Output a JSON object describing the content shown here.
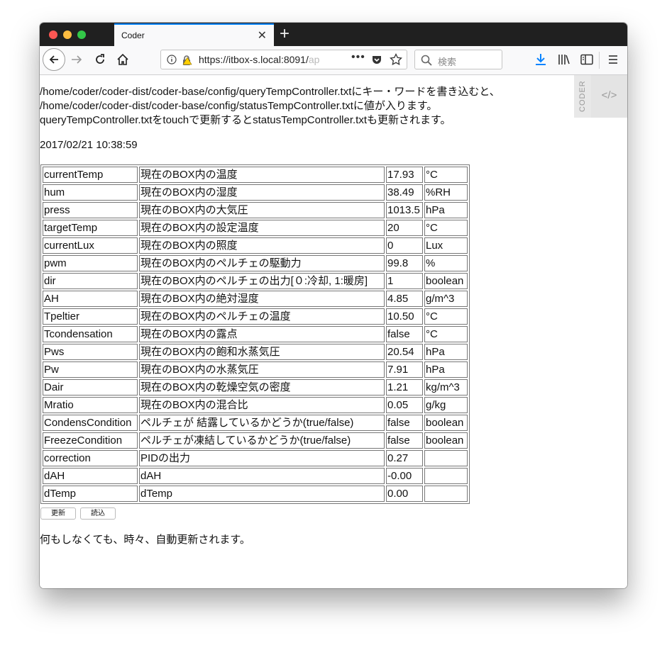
{
  "window": {
    "tab_title": "Coder"
  },
  "toolbar": {
    "url_main": "https://itbox-s.local:8091/",
    "url_faded": "ap",
    "url_more": "•••",
    "search_placeholder": "検索"
  },
  "sidebar": {
    "coder_label": "CODER",
    "code_label": "</>"
  },
  "intro": {
    "line1": "/home/coder/coder-dist/coder-base/config/queryTempController.txtにキー・ワードを書き込むと、",
    "line2": "/home/coder/coder-dist/coder-base/config/statusTempController.txtに値が入ります。",
    "line3": "queryTempController.txtをtouchで更新するとstatusTempController.txtも更新されます。"
  },
  "timestamp": "2017/02/21 10:38:59",
  "table": {
    "rows": [
      [
        "currentTemp",
        "現在のBOX内の温度",
        "17.93",
        "°C"
      ],
      [
        "hum",
        "現在のBOX内の湿度",
        "38.49",
        "%RH"
      ],
      [
        "press",
        "現在のBOX内の大気圧",
        "1013.5",
        "hPa"
      ],
      [
        "targetTemp",
        "現在のBOX内の設定温度",
        "20",
        "°C"
      ],
      [
        "currentLux",
        "現在のBOX内の照度",
        "0",
        "Lux"
      ],
      [
        "pwm",
        "現在のBOX内のペルチェの駆動力",
        "99.8",
        "%"
      ],
      [
        "dir",
        "現在のBOX内のペルチェの出力[０:冷却, 1:暖房]",
        "1",
        "boolean"
      ],
      [
        "AH",
        "現在のBOX内の絶対湿度",
        "4.85",
        "g/m^3"
      ],
      [
        "Tpeltier",
        "現在のBOX内のペルチェの温度",
        "10.50",
        "°C"
      ],
      [
        "Tcondensation",
        "現在のBOX内の露点",
        "false",
        "°C"
      ],
      [
        "Pws",
        "現在のBOX内の飽和水蒸気圧",
        "20.54",
        "hPa"
      ],
      [
        "Pw",
        "現在のBOX内の水蒸気圧",
        "7.91",
        "hPa"
      ],
      [
        "Dair",
        "現在のBOX内の乾燥空気の密度",
        "1.21",
        "kg/m^3"
      ],
      [
        "Mratio",
        "現在のBOX内の混合比",
        "0.05",
        "g/kg"
      ],
      [
        "CondensCondition",
        "ペルチェが 結露しているかどうか(true/false)",
        "false",
        "boolean"
      ],
      [
        "FreezeCondition",
        "ペルチェが凍結しているかどうか(true/false)",
        "false",
        "boolean"
      ],
      [
        "correction",
        "PIDの出力",
        "0.27",
        ""
      ],
      [
        "dAH",
        "dAH",
        "-0.00",
        ""
      ],
      [
        "dTemp",
        "dTemp",
        "0.00",
        ""
      ]
    ]
  },
  "buttons": {
    "update": "更新",
    "load": "読込"
  },
  "footer": "何もしなくても、時々、自動更新されます。"
}
